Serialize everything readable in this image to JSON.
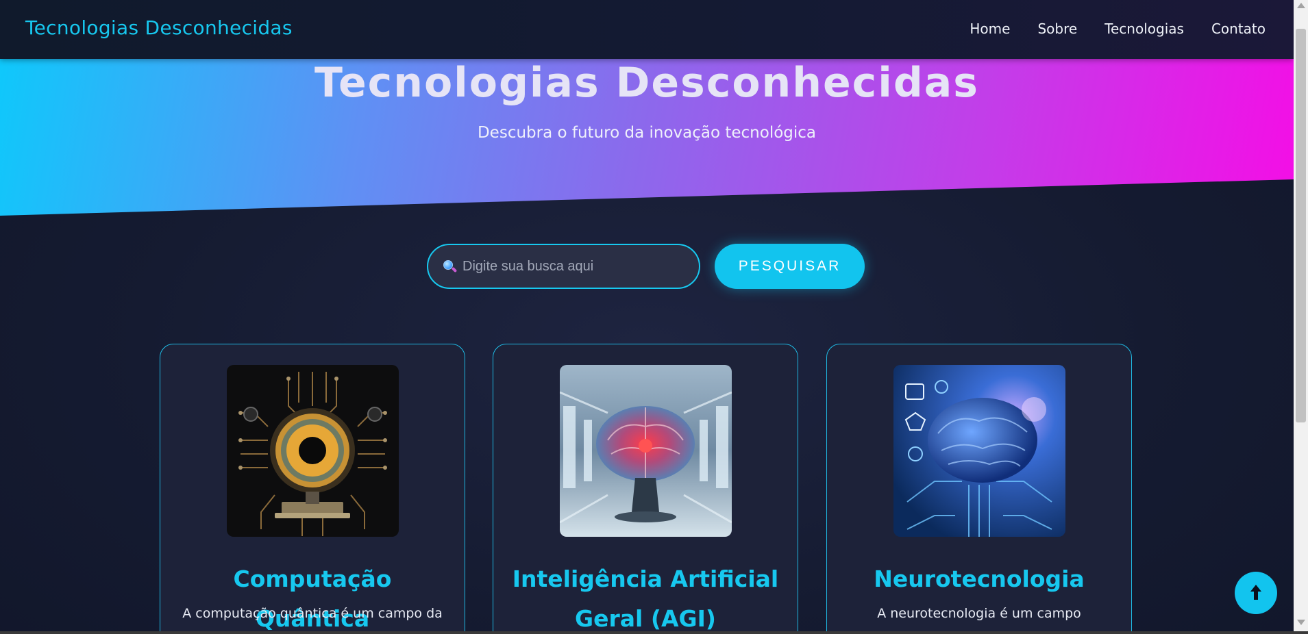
{
  "navbar": {
    "brand": "Tecnologias Desconhecidas",
    "links": [
      {
        "label": "Home"
      },
      {
        "label": "Sobre"
      },
      {
        "label": "Tecnologias"
      },
      {
        "label": "Contato"
      }
    ]
  },
  "hero": {
    "title": "Tecnologias Desconhecidas",
    "subtitle": "Descubra o futuro da inovação tecnológica"
  },
  "search": {
    "placeholder": "Digite sua busca aqui",
    "value": "",
    "button_label": "PESQUISAR"
  },
  "cards": [
    {
      "title": "Computação Quântica",
      "text": "A computação quântica é um campo da",
      "icon": "quantum-chip-icon"
    },
    {
      "title": "Inteligência Artificial Geral (AGI)",
      "text": "",
      "icon": "brain-lab-icon"
    },
    {
      "title": "Neurotecnologia",
      "text": "A neurotecnologia é um campo",
      "icon": "brain-circuit-icon"
    }
  ],
  "colors": {
    "accent": "#17c8ef",
    "background": "#151b31",
    "hero_gradient_start": "#0fc8fb",
    "hero_gradient_end": "#f40ee6"
  }
}
